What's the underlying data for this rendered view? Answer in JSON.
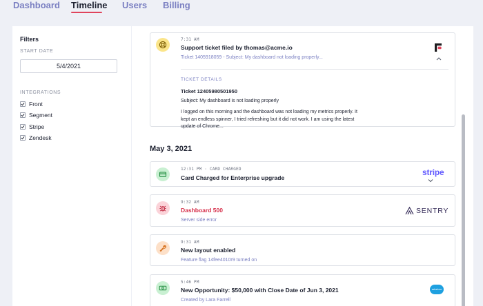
{
  "nav": {
    "tabs": [
      {
        "label": "Dashboard",
        "active": false
      },
      {
        "label": "Timeline",
        "active": true
      },
      {
        "label": "Users",
        "active": false
      },
      {
        "label": "Billing",
        "active": false
      }
    ]
  },
  "filters": {
    "title": "Filters",
    "start_date_label": "START DATE",
    "start_date_value": "5/4/2021",
    "integrations_label": "INTEGRATIONS",
    "integrations": [
      {
        "label": "Front",
        "checked": true
      },
      {
        "label": "Segment",
        "checked": true
      },
      {
        "label": "Stripe",
        "checked": true
      },
      {
        "label": "Zendesk",
        "checked": true
      }
    ]
  },
  "feed": {
    "top_card": {
      "time": "7:31 AM",
      "title": "Support ticket filed by thomas@acme.io",
      "subtitle": "Ticket 1405918059 - Subject: My dashboard not loading properly...",
      "icon": "lifebuoy-icon",
      "icon_bg": "#fbe58a",
      "logo": "front-logo",
      "details_label": "TICKET DETAILS",
      "ticket_id": "Ticket 12405980501950",
      "ticket_subject": "Subject: My dashboard is not loading properly",
      "ticket_body": "I logged on this morning and the dashboard was not loading my metrics properly. It kept an endless spinner, I tried refreshing but it did not work. I am using the latest update of Chrome..."
    },
    "day_heading": "May 3, 2021",
    "events": [
      {
        "time": "12:31 PM · CARD CHARGED",
        "title": "Card Charged for Enterprise upgrade",
        "subtitle": "",
        "icon": "credit-card-icon",
        "icon_bg": "#c9f0d2",
        "logo_text": "stripe"
      },
      {
        "time": "9:32 AM",
        "title": "Dashboard 500",
        "subtitle": "Server side error",
        "icon": "bug-icon",
        "icon_bg": "#fbd3d9",
        "logo_text": "SENTRY"
      },
      {
        "time": "9:31 AM",
        "title": "New layout enabled",
        "subtitle": "Feature flag 14fee4010r9 turned on",
        "icon": "wrench-icon",
        "icon_bg": "#fde0c8",
        "logo_text": ""
      },
      {
        "time": "5:46 PM",
        "title": "New Opportunity: $50,000 with Close Date of Jun 3, 2021",
        "subtitle": "Created by Lara Farrell",
        "icon": "money-icon",
        "icon_bg": "#c9f0d2",
        "logo_text": "salesforce"
      }
    ]
  },
  "colors": {
    "accent": "#e0445c",
    "link": "#7b80c2",
    "stripe": "#635bff",
    "salesforce": "#1ea0e0"
  }
}
